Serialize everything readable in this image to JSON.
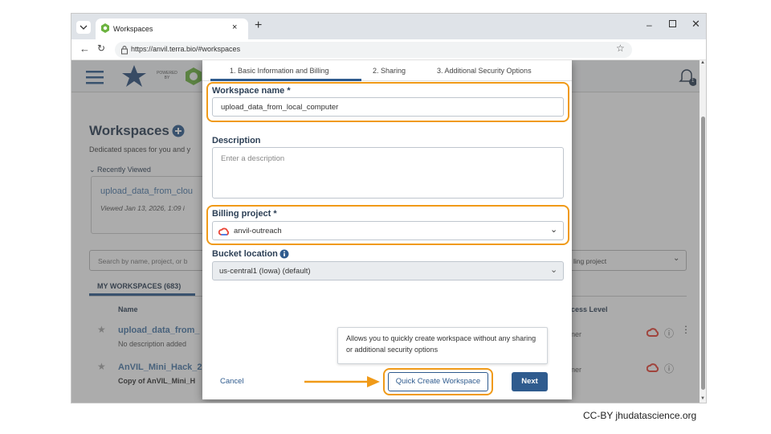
{
  "browser": {
    "tab_title": "Workspaces",
    "url": "https://anvil.terra.bio/#workspaces"
  },
  "app": {
    "logo_text": "POWERED BY",
    "page_title": "Workspaces",
    "subtitle": "Dedicated spaces for you and y",
    "recently_viewed_label": "Recently Viewed",
    "recent_card": {
      "name": "upload_data_from_clou",
      "viewed": "Viewed Jan 13, 2026, 1:09 i"
    },
    "search_placeholder": "Search by name, project, or b",
    "billing_filter": "ling project",
    "tab_label": "MY WORKSPACES (683)",
    "col_name": "Name",
    "col_access": "cess Level",
    "rows": [
      {
        "name": "upload_data_from_",
        "desc": "No description added",
        "access": "ner"
      },
      {
        "name": "AnVIL_Mini_Hack_2",
        "desc": "Copy of AnVIL_Mini_H",
        "access": "ner"
      }
    ],
    "notification_count": "1"
  },
  "modal": {
    "steps": [
      "1. Basic Information and Billing",
      "2. Sharing",
      "3. Additional Security Options"
    ],
    "workspace_name_label": "Workspace name *",
    "workspace_name_value": "upload_data_from_local_computer",
    "description_label": "Description",
    "description_placeholder": "Enter a description",
    "billing_label": "Billing project *",
    "billing_value": "anvil-outreach",
    "bucket_label": "Bucket location",
    "bucket_value": "us-central1 (Iowa) (default)",
    "tooltip": "Allows you to quickly create workspace without any sharing or additional security options",
    "cancel_label": "Cancel",
    "quick_create_label": "Quick Create Workspace",
    "next_label": "Next"
  },
  "credit": "CC-BY  jhudatascience.org",
  "colors": {
    "highlight": "#f09a18",
    "primary": "#2f5b8e",
    "link": "#4a78a8"
  }
}
